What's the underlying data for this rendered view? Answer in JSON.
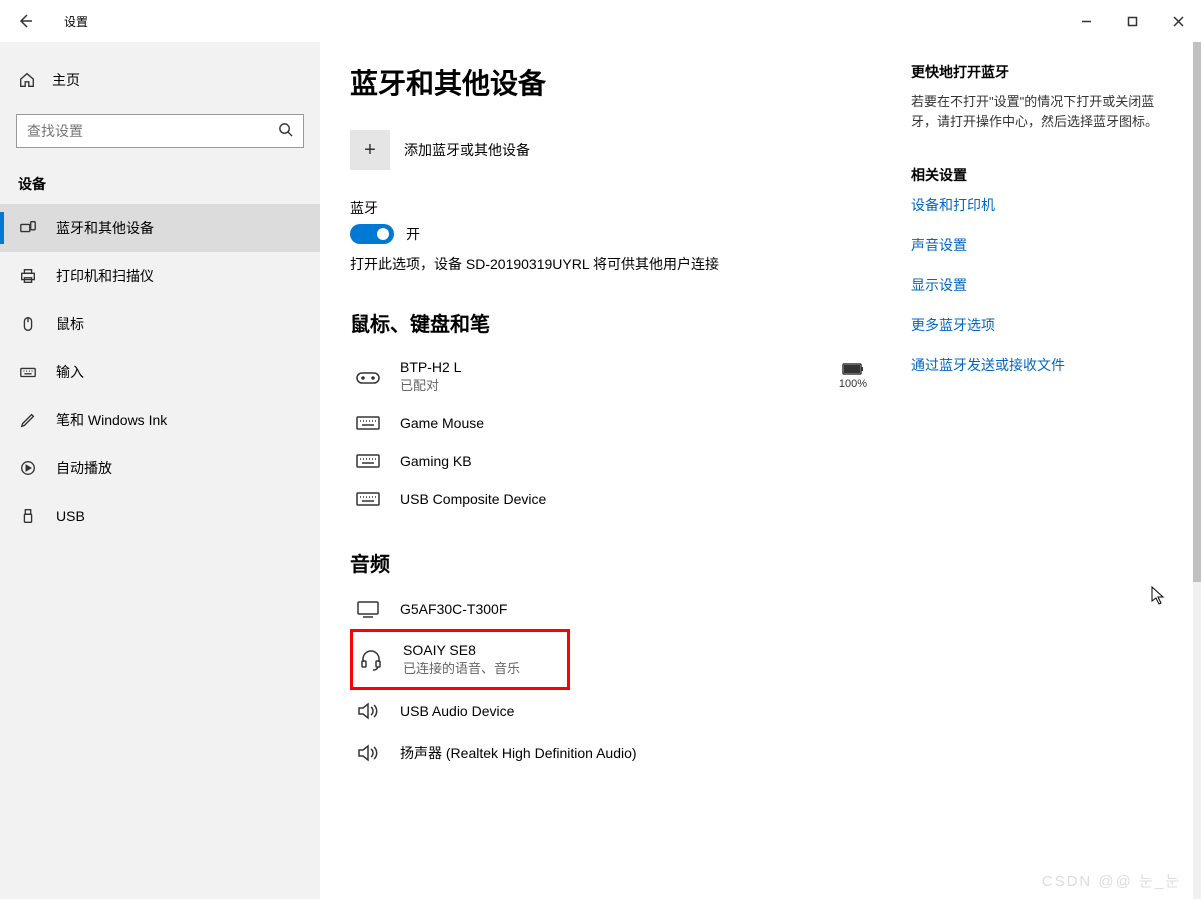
{
  "appTitle": "设置",
  "home": "主页",
  "search": {
    "placeholder": "查找设置"
  },
  "sidebarSection": "设备",
  "sidebar": [
    {
      "label": "蓝牙和其他设备"
    },
    {
      "label": "打印机和扫描仪"
    },
    {
      "label": "鼠标"
    },
    {
      "label": "输入"
    },
    {
      "label": "笔和 Windows Ink"
    },
    {
      "label": "自动播放"
    },
    {
      "label": "USB"
    }
  ],
  "page": {
    "title": "蓝牙和其他设备",
    "addLabel": "添加蓝牙或其他设备",
    "btHeading": "蓝牙",
    "btState": "开",
    "btHint": "打开此选项，设备 SD-20190319UYRL 将可供其他用户连接"
  },
  "groups": {
    "mkp": "鼠标、键盘和笔",
    "audio": "音频"
  },
  "devices": {
    "g1": [
      {
        "name": "BTP-H2 L",
        "status": "已配对",
        "battery": "100%"
      },
      {
        "name": "Game Mouse"
      },
      {
        "name": "Gaming KB"
      },
      {
        "name": "USB Composite Device"
      }
    ],
    "g2": [
      {
        "name": "G5AF30C-T300F"
      },
      {
        "name": "SOAIY SE8",
        "status": "已连接的语音、音乐"
      },
      {
        "name": "USB Audio Device"
      },
      {
        "name": "扬声器 (Realtek High Definition Audio)"
      }
    ]
  },
  "side": {
    "quickH": "更快地打开蓝牙",
    "quickP": "若要在不打开\"设置\"的情况下打开或关闭蓝牙，请打开操作中心，然后选择蓝牙图标。",
    "relatedH": "相关设置",
    "links": [
      "设备和打印机",
      "声音设置",
      "显示设置",
      "更多蓝牙选项",
      "通过蓝牙发送或接收文件"
    ]
  },
  "watermark": "CSDN @@      눈_눈"
}
